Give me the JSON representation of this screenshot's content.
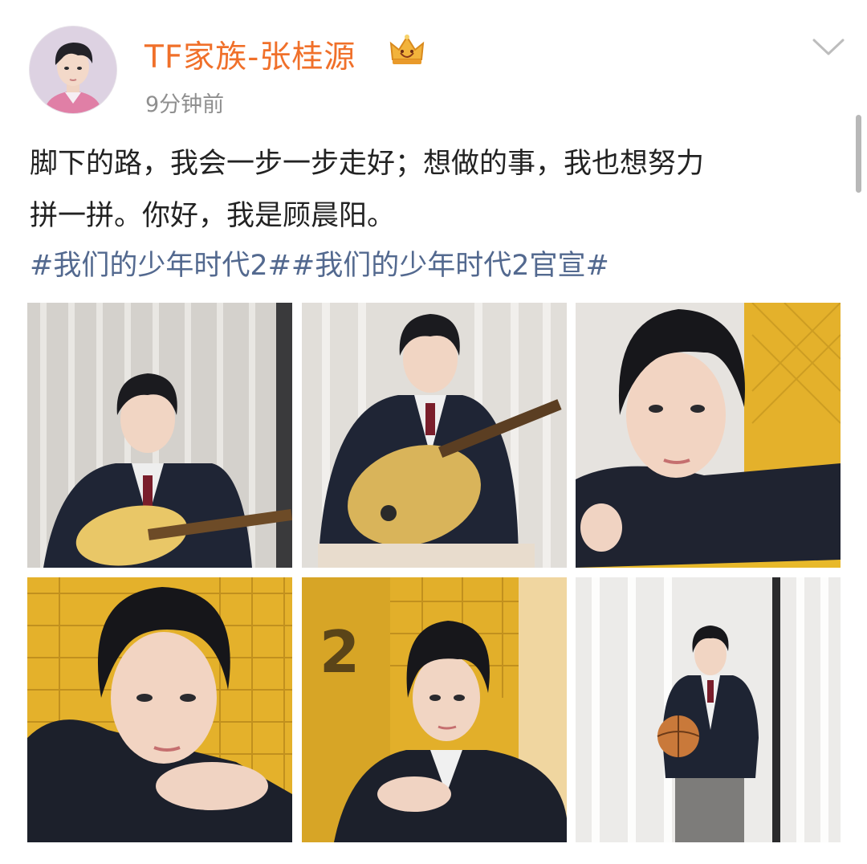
{
  "post": {
    "username": "TF家族-张桂源",
    "timestamp": "9分钟前",
    "text_lines": [
      "脚下的路，我会一步一步走好；想做的事，我也想努力",
      "拼一拼。你好，我是顾晨阳。"
    ],
    "hashtags": [
      "#我们的少年时代2#",
      "#我们的少年时代2官宣#"
    ],
    "badge_icon": "crown-icon",
    "menu_icon": "chevron-down-icon"
  },
  "photos": [
    {
      "scene": "guitar-seated-curtain",
      "palette": [
        "#d9d6d1",
        "#1e2433",
        "#e6c56a"
      ]
    },
    {
      "scene": "guitar-playing-curtain",
      "palette": [
        "#e3e0dc",
        "#1e2433",
        "#d9b45a"
      ]
    },
    {
      "scene": "closeup-arm-rest-yellow",
      "palette": [
        "#e9e6e2",
        "#20242f",
        "#e8b92a"
      ]
    },
    {
      "scene": "closeup-yellow-mesh",
      "palette": [
        "#e6b42a",
        "#1c202b",
        "#f3e7b0"
      ]
    },
    {
      "scene": "locker-number-2",
      "palette": [
        "#e4b12b",
        "#1c202b",
        "#c99d2a"
      ]
    },
    {
      "scene": "basketball-standing-curtain",
      "palette": [
        "#efeeec",
        "#1e2433",
        "#c9793a"
      ]
    }
  ],
  "locker_number": "2"
}
